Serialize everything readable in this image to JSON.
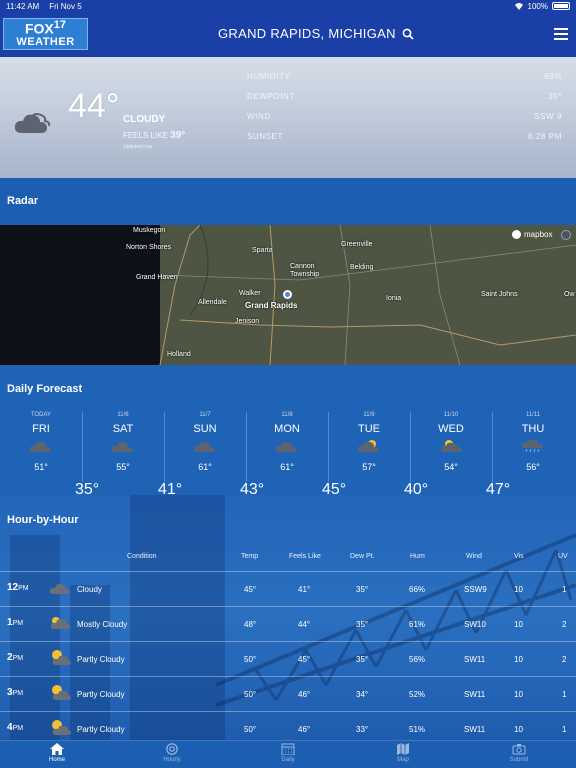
{
  "status_bar": {
    "time": "11:42 AM",
    "date": "Fri Nov 5",
    "battery": "100%"
  },
  "header": {
    "logo_line1": "FOX",
    "logo_number": "17",
    "logo_line2": "WEATHER",
    "location": "GRAND RAPIDS, MICHIGAN"
  },
  "current": {
    "temp": "44°",
    "condition": "CLOUDY",
    "feels_label": "FEELS LIKE",
    "feels_value": "39°",
    "updated": "Updated now",
    "stats": [
      {
        "label": "HUMIDITY",
        "value": "69%"
      },
      {
        "label": "DEWPOINT",
        "value": "35°"
      },
      {
        "label": "WIND",
        "value": "SSW 9"
      },
      {
        "label": "SUNSET",
        "value": "6:28 PM"
      }
    ]
  },
  "radar": {
    "title": "Radar",
    "attribution": "mapbox",
    "places": [
      "Muskegon",
      "Norton Shores",
      "Grand Haven",
      "Allendale",
      "Walker",
      "Grand Rapids",
      "Jenison",
      "Holland",
      "Sparta",
      "Cannon Township",
      "Greenville",
      "Belding",
      "Ionia",
      "Saint Johns",
      "Ow"
    ]
  },
  "daily": {
    "title": "Daily Forecast",
    "days": [
      {
        "sub": "TODAY",
        "name": "FRI",
        "high": "51°",
        "low": "35°",
        "icon": "cloudy-icon"
      },
      {
        "sub": "11/6",
        "name": "SAT",
        "high": "55°",
        "low": "41°",
        "icon": "cloudy-icon"
      },
      {
        "sub": "11/7",
        "name": "SUN",
        "high": "61°",
        "low": "43°",
        "icon": "cloudy-icon"
      },
      {
        "sub": "11/8",
        "name": "MON",
        "high": "61°",
        "low": "45°",
        "icon": "cloudy-icon"
      },
      {
        "sub": "11/9",
        "name": "TUE",
        "high": "57°",
        "low": "40°",
        "icon": "partly-cloudy-icon"
      },
      {
        "sub": "11/10",
        "name": "WED",
        "high": "54°",
        "low": "47°",
        "icon": "partly-cloudy-icon"
      },
      {
        "sub": "11/11",
        "name": "THU",
        "high": "56°",
        "low": "",
        "icon": "rain-icon"
      }
    ]
  },
  "hourly": {
    "title": "Hour-by-Hour",
    "columns": [
      "Condition",
      "Temp",
      "Feels Like",
      "Dew Pt.",
      "Hum",
      "Wind",
      "Vis",
      "UV"
    ],
    "rows": [
      {
        "hour": "12",
        "ampm": "PM",
        "condition": "Cloudy",
        "temp": "45°",
        "feels": "41°",
        "dew": "35°",
        "hum": "66%",
        "wind": "SSW9",
        "vis": "10",
        "uv": "1"
      },
      {
        "hour": "1",
        "ampm": "PM",
        "condition": "Mostly Cloudy",
        "temp": "48°",
        "feels": "44°",
        "dew": "35°",
        "hum": "61%",
        "wind": "SW10",
        "vis": "10",
        "uv": "2"
      },
      {
        "hour": "2",
        "ampm": "PM",
        "condition": "Partly Cloudy",
        "temp": "50°",
        "feels": "45°",
        "dew": "35°",
        "hum": "56%",
        "wind": "SW11",
        "vis": "10",
        "uv": "2"
      },
      {
        "hour": "3",
        "ampm": "PM",
        "condition": "Partly Cloudy",
        "temp": "50°",
        "feels": "46°",
        "dew": "34°",
        "hum": "52%",
        "wind": "SW11",
        "vis": "10",
        "uv": "1"
      },
      {
        "hour": "4",
        "ampm": "PM",
        "condition": "Partly Cloudy",
        "temp": "50°",
        "feels": "46°",
        "dew": "33°",
        "hum": "51%",
        "wind": "SW11",
        "vis": "10",
        "uv": "1"
      }
    ]
  },
  "tabs": [
    "Home",
    "Hourly",
    "Daily",
    "Map",
    "Submit"
  ]
}
